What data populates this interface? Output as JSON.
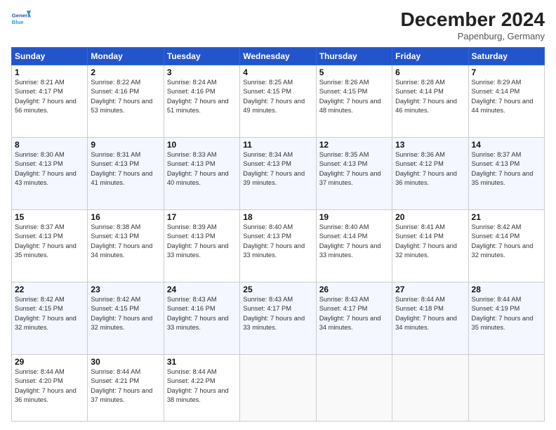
{
  "header": {
    "logo_general": "General",
    "logo_blue": "Blue",
    "month": "December 2024",
    "location": "Papenburg, Germany"
  },
  "days_of_week": [
    "Sunday",
    "Monday",
    "Tuesday",
    "Wednesday",
    "Thursday",
    "Friday",
    "Saturday"
  ],
  "weeks": [
    [
      {
        "day": 1,
        "sunrise": "8:21 AM",
        "sunset": "4:17 PM",
        "daylight": "7 hours and 56 minutes."
      },
      {
        "day": 2,
        "sunrise": "8:22 AM",
        "sunset": "4:16 PM",
        "daylight": "7 hours and 53 minutes."
      },
      {
        "day": 3,
        "sunrise": "8:24 AM",
        "sunset": "4:16 PM",
        "daylight": "7 hours and 51 minutes."
      },
      {
        "day": 4,
        "sunrise": "8:25 AM",
        "sunset": "4:15 PM",
        "daylight": "7 hours and 49 minutes."
      },
      {
        "day": 5,
        "sunrise": "8:26 AM",
        "sunset": "4:15 PM",
        "daylight": "7 hours and 48 minutes."
      },
      {
        "day": 6,
        "sunrise": "8:28 AM",
        "sunset": "4:14 PM",
        "daylight": "7 hours and 46 minutes."
      },
      {
        "day": 7,
        "sunrise": "8:29 AM",
        "sunset": "4:14 PM",
        "daylight": "7 hours and 44 minutes."
      }
    ],
    [
      {
        "day": 8,
        "sunrise": "8:30 AM",
        "sunset": "4:13 PM",
        "daylight": "7 hours and 43 minutes."
      },
      {
        "day": 9,
        "sunrise": "8:31 AM",
        "sunset": "4:13 PM",
        "daylight": "7 hours and 41 minutes."
      },
      {
        "day": 10,
        "sunrise": "8:33 AM",
        "sunset": "4:13 PM",
        "daylight": "7 hours and 40 minutes."
      },
      {
        "day": 11,
        "sunrise": "8:34 AM",
        "sunset": "4:13 PM",
        "daylight": "7 hours and 39 minutes."
      },
      {
        "day": 12,
        "sunrise": "8:35 AM",
        "sunset": "4:13 PM",
        "daylight": "7 hours and 37 minutes."
      },
      {
        "day": 13,
        "sunrise": "8:36 AM",
        "sunset": "4:12 PM",
        "daylight": "7 hours and 36 minutes."
      },
      {
        "day": 14,
        "sunrise": "8:37 AM",
        "sunset": "4:13 PM",
        "daylight": "7 hours and 35 minutes."
      }
    ],
    [
      {
        "day": 15,
        "sunrise": "8:37 AM",
        "sunset": "4:13 PM",
        "daylight": "7 hours and 35 minutes."
      },
      {
        "day": 16,
        "sunrise": "8:38 AM",
        "sunset": "4:13 PM",
        "daylight": "7 hours and 34 minutes."
      },
      {
        "day": 17,
        "sunrise": "8:39 AM",
        "sunset": "4:13 PM",
        "daylight": "7 hours and 33 minutes."
      },
      {
        "day": 18,
        "sunrise": "8:40 AM",
        "sunset": "4:13 PM",
        "daylight": "7 hours and 33 minutes."
      },
      {
        "day": 19,
        "sunrise": "8:40 AM",
        "sunset": "4:14 PM",
        "daylight": "7 hours and 33 minutes."
      },
      {
        "day": 20,
        "sunrise": "8:41 AM",
        "sunset": "4:14 PM",
        "daylight": "7 hours and 32 minutes."
      },
      {
        "day": 21,
        "sunrise": "8:42 AM",
        "sunset": "4:14 PM",
        "daylight": "7 hours and 32 minutes."
      }
    ],
    [
      {
        "day": 22,
        "sunrise": "8:42 AM",
        "sunset": "4:15 PM",
        "daylight": "7 hours and 32 minutes."
      },
      {
        "day": 23,
        "sunrise": "8:42 AM",
        "sunset": "4:15 PM",
        "daylight": "7 hours and 32 minutes."
      },
      {
        "day": 24,
        "sunrise": "8:43 AM",
        "sunset": "4:16 PM",
        "daylight": "7 hours and 33 minutes."
      },
      {
        "day": 25,
        "sunrise": "8:43 AM",
        "sunset": "4:17 PM",
        "daylight": "7 hours and 33 minutes."
      },
      {
        "day": 26,
        "sunrise": "8:43 AM",
        "sunset": "4:17 PM",
        "daylight": "7 hours and 34 minutes."
      },
      {
        "day": 27,
        "sunrise": "8:44 AM",
        "sunset": "4:18 PM",
        "daylight": "7 hours and 34 minutes."
      },
      {
        "day": 28,
        "sunrise": "8:44 AM",
        "sunset": "4:19 PM",
        "daylight": "7 hours and 35 minutes."
      }
    ],
    [
      {
        "day": 29,
        "sunrise": "8:44 AM",
        "sunset": "4:20 PM",
        "daylight": "7 hours and 36 minutes."
      },
      {
        "day": 30,
        "sunrise": "8:44 AM",
        "sunset": "4:21 PM",
        "daylight": "7 hours and 37 minutes."
      },
      {
        "day": 31,
        "sunrise": "8:44 AM",
        "sunset": "4:22 PM",
        "daylight": "7 hours and 38 minutes."
      },
      null,
      null,
      null,
      null
    ]
  ]
}
